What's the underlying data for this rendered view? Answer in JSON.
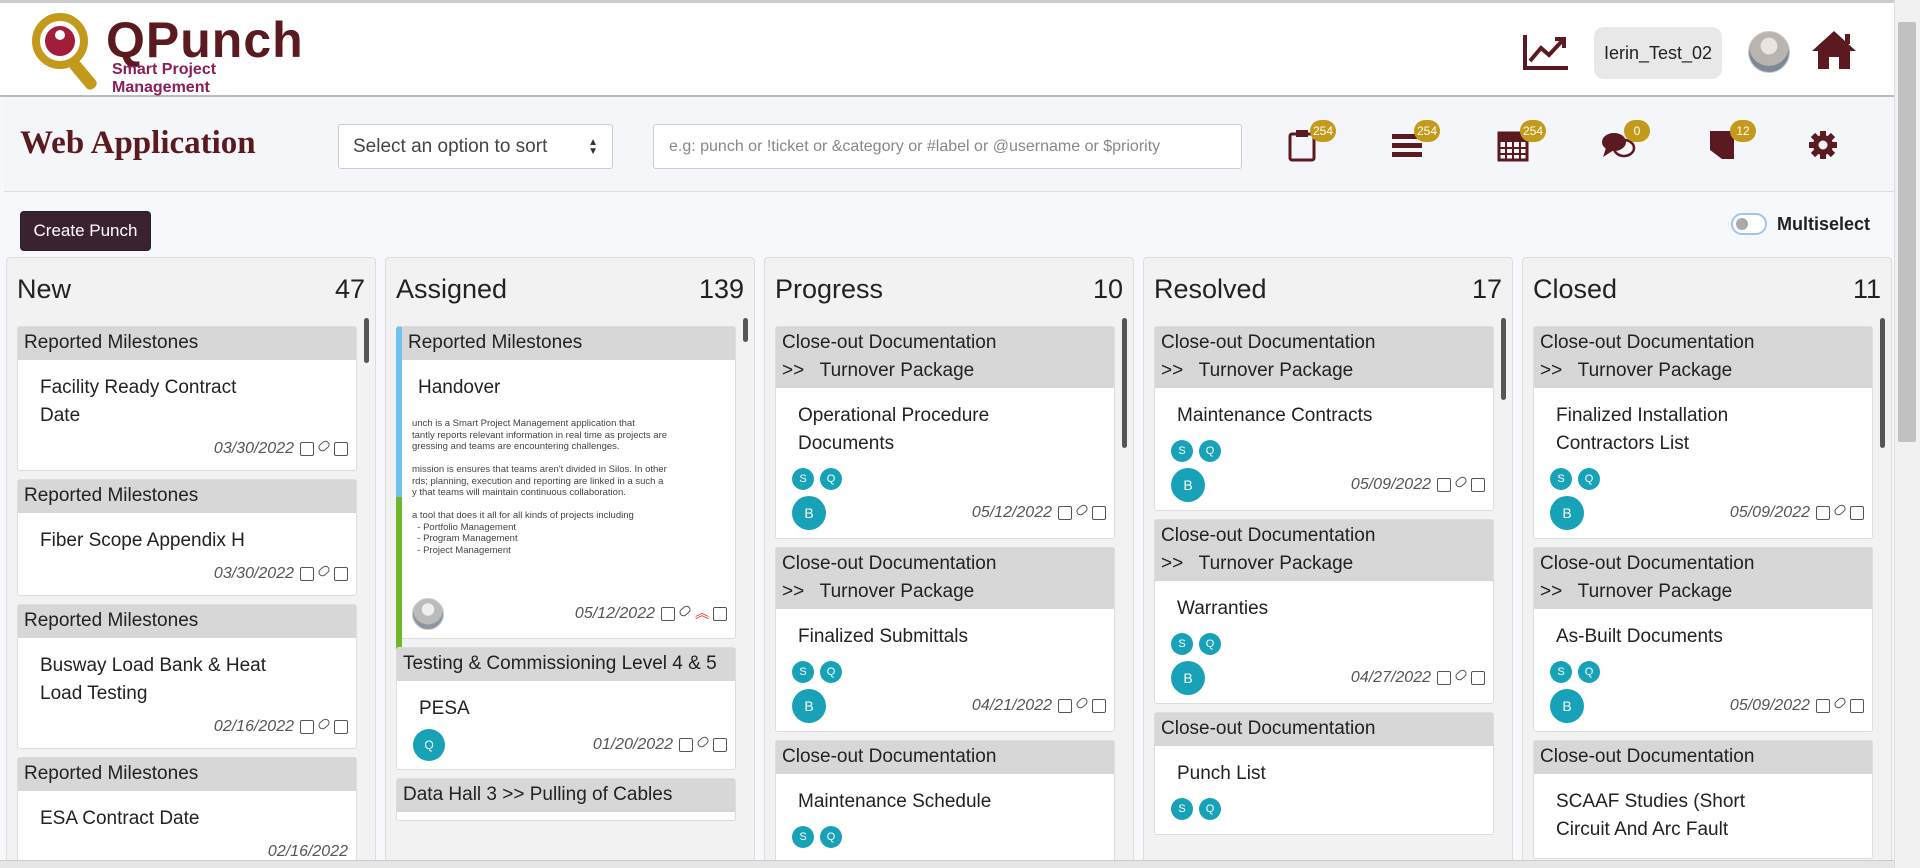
{
  "header": {
    "logo_title": "QPunch",
    "logo_subtitle": "Smart Project Management",
    "username": "Ierin_Test_02"
  },
  "subbar": {
    "app_title": "Web Application",
    "sort_placeholder": "Select an option to sort",
    "search_placeholder": "e.g: punch or !ticket or &category or #label or @username or $priority",
    "badges": {
      "punches": "254",
      "list": "254",
      "calendar": "254",
      "comments": "0",
      "bookmarks": "12"
    }
  },
  "toolbar": {
    "create_label": "Create Punch",
    "multiselect_label": "Multiselect"
  },
  "columns": {
    "new": {
      "title": "New",
      "count": "47",
      "cards": [
        {
          "cat": "Reported Milestones",
          "title": "Facility Ready Contract Date",
          "date": "03/30/2022"
        },
        {
          "cat": "Reported Milestones",
          "title": "Fiber Scope Appendix H",
          "date": "03/30/2022"
        },
        {
          "cat": "Reported Milestones",
          "title": "Busway Load Bank & Heat Load Testing",
          "date": "02/16/2022"
        },
        {
          "cat": "Reported Milestones",
          "title": "ESA Contract Date",
          "date": "02/16/2022"
        }
      ]
    },
    "assigned": {
      "title": "Assigned",
      "count": "139",
      "cards": [
        {
          "cat": "Reported Milestones",
          "title": "Handover",
          "date": "05/12/2022",
          "desc": [
            "unch is a Smart Project Management application that",
            "tantly reports relevant information in real time as projects are",
            "gressing and teams are encountering challenges.",
            "",
            " mission is ensures that teams aren't divided in Silos. In other",
            "rds; planning, execution and reporting are linked in a such a",
            "y that teams will maintain continuous collaboration.",
            "",
            "a tool that does it all for all kinds of projects including",
            "  - Portfolio Management",
            "  - Program Management",
            "  - Project Management"
          ]
        },
        {
          "cat": "Testing & Commissioning Level 4 & 5",
          "title": "PESA",
          "date": "01/20/2022",
          "chip": "Q"
        },
        {
          "cat": "Data Hall 3 >>   Pulling of Cables"
        }
      ]
    },
    "progress": {
      "title": "Progress",
      "count": "10",
      "cards": [
        {
          "cat1": "Close-out Documentation",
          "cat2": ">>   Turnover Package",
          "title": "Operational Procedure Documents",
          "date": "05/12/2022"
        },
        {
          "cat1": "Close-out Documentation",
          "cat2": ">>   Turnover Package",
          "title": "Finalized Submittals",
          "date": "04/21/2022"
        },
        {
          "cat1": "Close-out Documentation",
          "title": "Maintenance Schedule"
        }
      ]
    },
    "resolved": {
      "title": "Resolved",
      "count": "17",
      "cards": [
        {
          "cat1": "Close-out Documentation",
          "cat2": ">>   Turnover Package",
          "title": "Maintenance Contracts",
          "date": "05/09/2022"
        },
        {
          "cat1": "Close-out Documentation",
          "cat2": ">>   Turnover Package",
          "title": "Warranties",
          "date": "04/27/2022"
        },
        {
          "cat1": "Close-out Documentation",
          "title": "Punch List"
        }
      ]
    },
    "closed": {
      "title": "Closed",
      "count": "11",
      "cards": [
        {
          "cat1": "Close-out Documentation",
          "cat2": ">>   Turnover Package",
          "title": "Finalized Installation Contractors List",
          "date": "05/09/2022"
        },
        {
          "cat1": "Close-out Documentation",
          "cat2": ">>   Turnover Package",
          "title": "As-Built Documents",
          "date": "05/09/2022"
        },
        {
          "cat1": "Close-out Documentation",
          "title": "SCAAF Studies (Short Circuit And Arc Fault"
        }
      ]
    }
  },
  "chips": {
    "s": "S",
    "q": "Q",
    "b": "B"
  },
  "colors": {
    "brand": "#5b1a1f",
    "accent": "#c49a1a",
    "chip": "#17a2b8",
    "button": "#3b2230"
  }
}
